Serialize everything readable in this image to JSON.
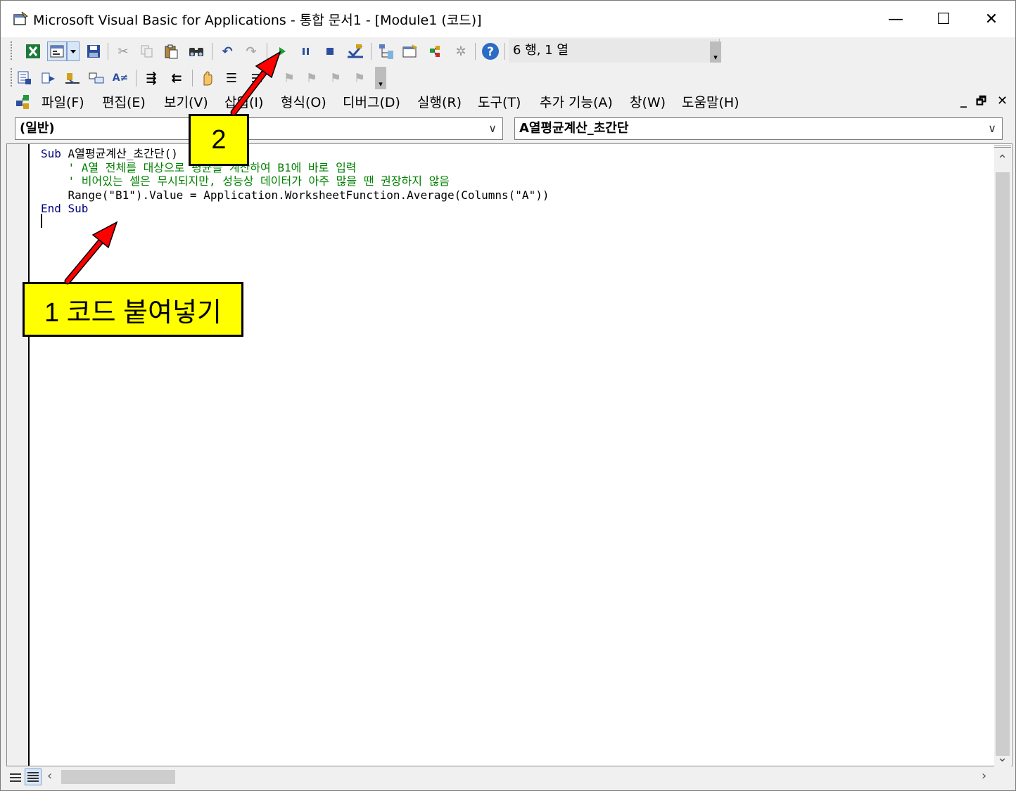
{
  "window": {
    "title": "Microsoft Visual Basic for Applications - 통합 문서1 - [Module1 (코드)]",
    "minimize_glyph": "—",
    "maximize_glyph": "☐",
    "close_glyph": "✕"
  },
  "toolbar": {
    "cursor_position": "6 행, 1 열",
    "icons": [
      "excel-view-icon",
      "insert-form-icon",
      "save-icon",
      "cut-icon",
      "copy-icon",
      "paste-icon",
      "find-icon",
      "undo-icon",
      "redo-icon",
      "run-icon",
      "break-icon",
      "reset-icon",
      "design-mode-icon",
      "project-explorer-icon",
      "properties-icon",
      "object-browser-icon",
      "toolbox-icon",
      "help-icon"
    ]
  },
  "menu": {
    "items": [
      "파일(F)",
      "편집(E)",
      "보기(V)",
      "삽입(I)",
      "형식(O)",
      "디버그(D)",
      "실행(R)",
      "도구(T)",
      "추가 기능(A)",
      "창(W)",
      "도움말(H)"
    ],
    "mdi_minimize": "_",
    "mdi_restore": "🗗",
    "mdi_close": "✕"
  },
  "combos": {
    "object": "(일반)",
    "procedure": "A열평균계산_초간단"
  },
  "code": {
    "line1_kw": "Sub",
    "line1_name": " A열평균계산_초간단()",
    "line2": "    ' A열 전체를 대상으로 평균을 계산하여 B1에 바로 입력",
    "line3": "    ' 비어있는 셀은 무시되지만, 성능상 데이터가 아주 많을 땐 권장하지 않음",
    "line4": "    Range(\"B1\").Value = Application.WorksheetFunction.Average(Columns(\"A\"))",
    "line5_kw": "End Sub"
  },
  "annotations": {
    "callout1": "1 코드 붙여넣기",
    "callout2": "2"
  },
  "colors": {
    "keyword": "#00007f",
    "comment": "#008000",
    "callout_bg": "#ffff00",
    "arrow": "#ff0000"
  }
}
